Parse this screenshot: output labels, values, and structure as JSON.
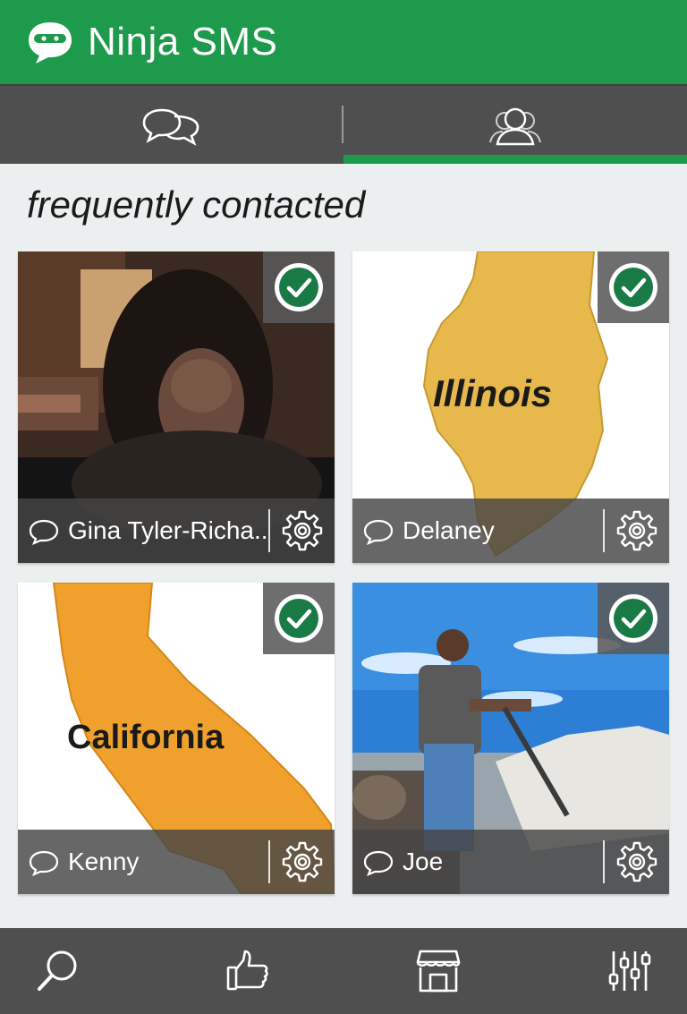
{
  "app": {
    "title": "Ninja SMS",
    "brand_color": "#1e9a4c"
  },
  "tabs": [
    {
      "icon": "chat-bubbles-icon",
      "selected": false
    },
    {
      "icon": "contacts-icon",
      "selected": true
    }
  ],
  "section": {
    "title": "frequently contacted"
  },
  "contacts": [
    {
      "name": "Gina Tyler-Richa..",
      "selected": true,
      "photo": "person-photo"
    },
    {
      "name": "Delaney",
      "selected": true,
      "photo": "illinois-map"
    },
    {
      "name": "Kenny",
      "selected": true,
      "photo": "california-map"
    },
    {
      "name": "Joe",
      "selected": true,
      "photo": "person-outdoors-photo"
    }
  ],
  "map_labels": {
    "illinois": "Illinois",
    "california": "California"
  },
  "bottom_nav": [
    {
      "icon": "search-icon"
    },
    {
      "icon": "thumbs-up-icon"
    },
    {
      "icon": "store-icon"
    },
    {
      "icon": "sliders-icon"
    }
  ]
}
